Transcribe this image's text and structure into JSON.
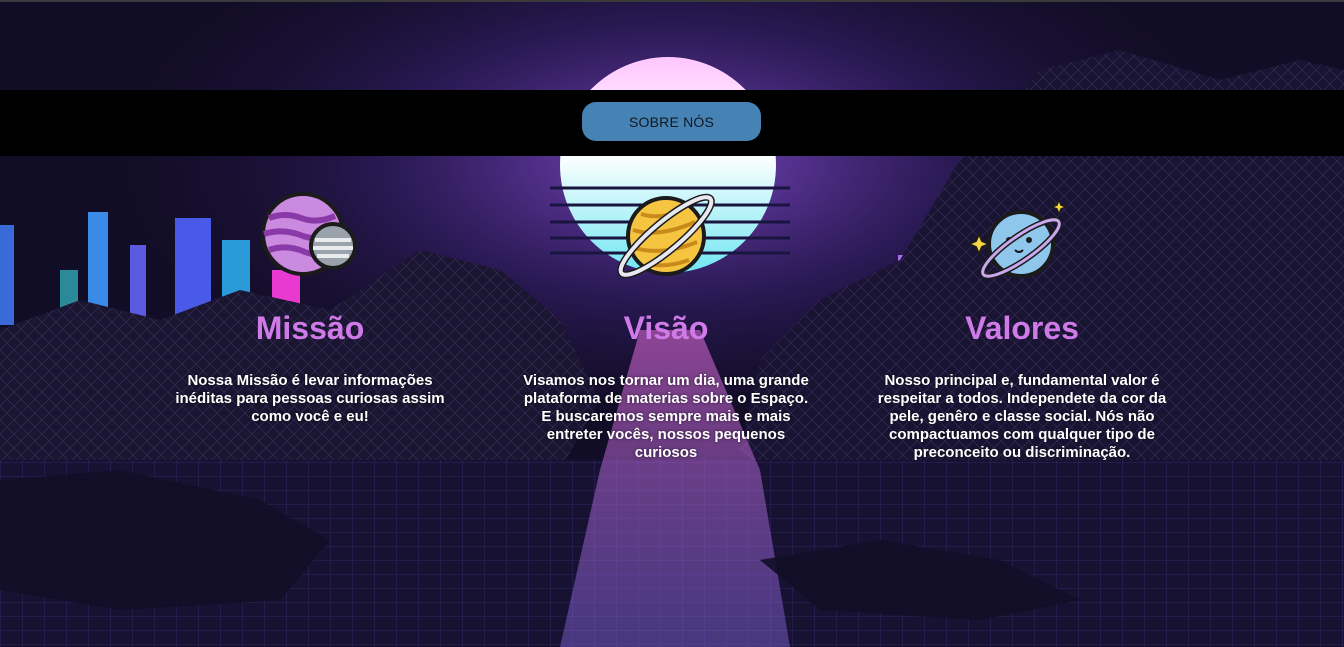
{
  "nav": {
    "button_label": "SOBRE NÓS"
  },
  "cards": [
    {
      "icon": "striped-planet-icon",
      "title": "Missão",
      "text": "Nossa Missão é levar informações inéditas para pessoas curiosas assim como você e eu!"
    },
    {
      "icon": "ringed-planet-icon",
      "title": "Visão",
      "text": "Visamos nos tornar um dia, uma grande plataforma de materias sobre o Espaço. E buscaremos sempre mais e mais entreter vocês, nossos pequenos curiosos"
    },
    {
      "icon": "cute-planet-icon",
      "title": "Valores",
      "text": "Nosso principal e, fundamental valor é respeitar a todos. Independete da cor da pele, genêro e classe social. Nós não compactuamos com qualquer tipo de preconceito ou discriminação."
    }
  ],
  "colors": {
    "title": "#d07ae8",
    "button": "#4682b4",
    "navbar": "#000000",
    "sun": "#f5b8ff",
    "grid": "#4a3a9a"
  }
}
